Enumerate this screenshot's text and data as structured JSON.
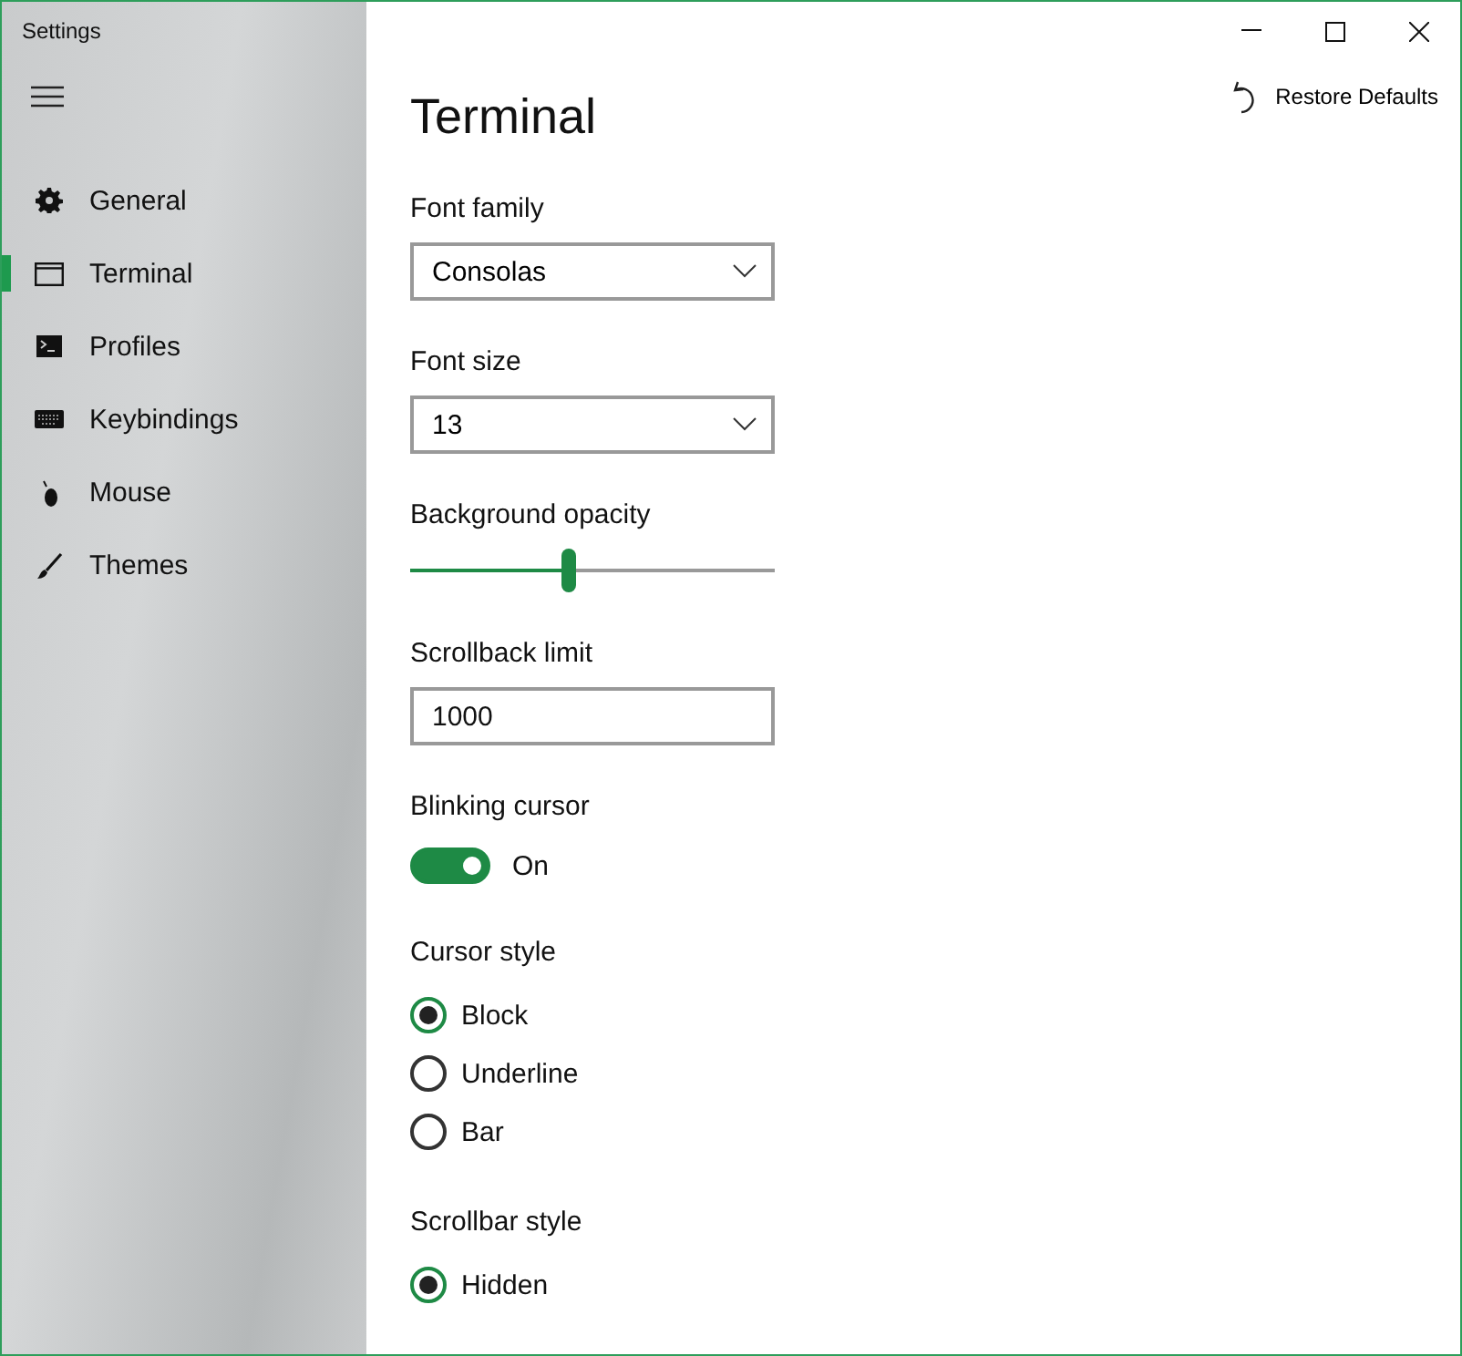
{
  "window": {
    "title": "Settings"
  },
  "nav": [
    {
      "label": "General",
      "selected": false
    },
    {
      "label": "Terminal",
      "selected": true
    },
    {
      "label": "Profiles",
      "selected": false
    },
    {
      "label": "Keybindings",
      "selected": false
    },
    {
      "label": "Mouse",
      "selected": false
    },
    {
      "label": "Themes",
      "selected": false
    }
  ],
  "page": {
    "title": "Terminal",
    "restore_button": "Restore Defaults"
  },
  "settings": [
    {
      "kind": "dropdown",
      "label": "Font family",
      "value": "Consolas"
    },
    {
      "kind": "dropdown",
      "label": "Font size",
      "value": "13"
    },
    {
      "kind": "slider",
      "label": "Background opacity",
      "level": 0.435
    },
    {
      "kind": "textbox",
      "label": "Scrollback limit",
      "value": "1000"
    },
    {
      "kind": "toggle",
      "label": "Blinking cursor",
      "on": true,
      "state_text": "On"
    },
    {
      "kind": "radio",
      "label": "Cursor style",
      "options": [
        {
          "label": "Block",
          "selected": true
        },
        {
          "label": "Underline",
          "selected": false
        },
        {
          "label": "Bar",
          "selected": false
        }
      ]
    },
    {
      "kind": "radio",
      "label": "Scrollbar style",
      "options": [
        {
          "label": "Hidden",
          "selected": true
        }
      ]
    }
  ]
}
